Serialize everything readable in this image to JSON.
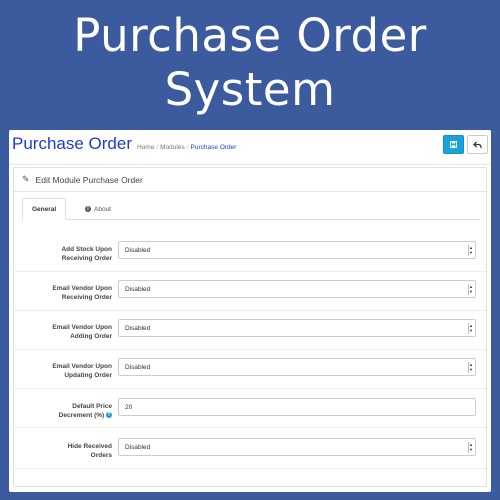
{
  "banner": {
    "line1": "Purchase Order",
    "line2": "System"
  },
  "header": {
    "title": "Purchase Order",
    "breadcrumb": [
      "Home",
      "Modules",
      "Purchase Order"
    ]
  },
  "panel": {
    "title": "Edit Module Purchase Order"
  },
  "tabs": [
    {
      "label": "General",
      "active": true
    },
    {
      "label": "About",
      "active": false
    }
  ],
  "fields": [
    {
      "label_line1": "Add Stock Upon",
      "label_line2": "Receiving Order",
      "value": "Disabled",
      "type": "select"
    },
    {
      "label_line1": "Email Vendor Upon",
      "label_line2": "Receiving Order",
      "value": "Disabled",
      "type": "select"
    },
    {
      "label_line1": "Email Vendor Upon",
      "label_line2": "Adding Order",
      "value": "Disabled",
      "type": "select"
    },
    {
      "label_line1": "Email Vendor Upon",
      "label_line2": "Updating Order",
      "value": "Disabled",
      "type": "select"
    },
    {
      "label_line1": "Default Price",
      "label_line2": "Decrement (%)",
      "value": "20",
      "type": "input"
    },
    {
      "label_line1": "Hide Received",
      "label_line2": "Orders",
      "value": "Disabled",
      "type": "select"
    }
  ],
  "icons": {
    "save": "save-icon",
    "back": "reply-icon",
    "edit": "pencil-icon",
    "info": "info-icon",
    "help": "question-icon"
  },
  "colors": {
    "background": "#3c5a9e",
    "title": "#1e3ccd",
    "save_button": "#1ea1db"
  }
}
